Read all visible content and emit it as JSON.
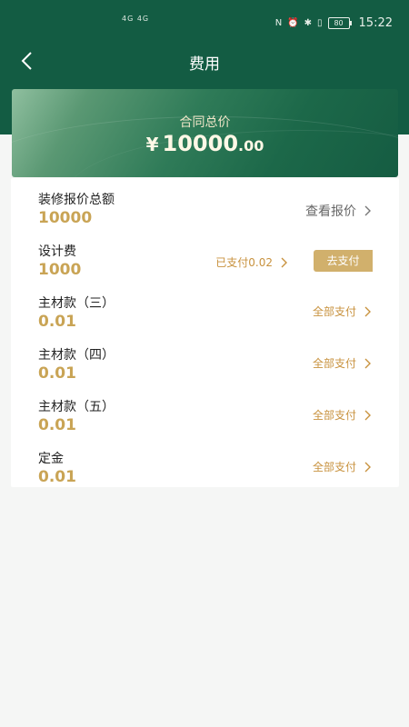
{
  "status_bar": {
    "left_text": "4G 4G",
    "battery": "80",
    "time": "15:22"
  },
  "nav": {
    "title": "费用",
    "back_icon": "chevron-left-icon"
  },
  "summary": {
    "label": "合同总价",
    "currency": "¥",
    "amount_integer": "10000",
    "amount_decimal": ".00"
  },
  "rows": [
    {
      "label": "装修报价总额",
      "value": "10000",
      "action": "查看报价"
    },
    {
      "label": "设计费",
      "value": "1000",
      "paid": "已支付0.02",
      "button": "去支付"
    },
    {
      "label": "主材款（三）",
      "value": "0.01",
      "action": "全部支付"
    },
    {
      "label": "主材款（四）",
      "value": "0.01",
      "action": "全部支付"
    },
    {
      "label": "主材款（五）",
      "value": "0.01",
      "action": "全部支付"
    },
    {
      "label": "定金",
      "value": "0.01",
      "action": "全部支付"
    }
  ],
  "colors": {
    "header": "#135c43",
    "gold": "#c9a455",
    "button": "#d1b06c"
  }
}
